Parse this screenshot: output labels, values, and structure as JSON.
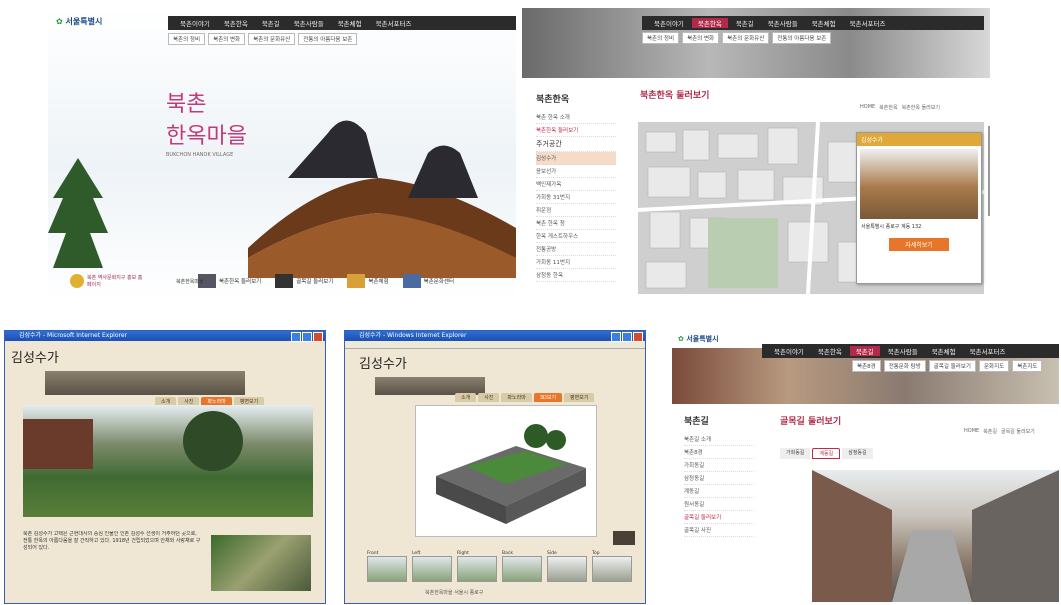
{
  "panel1": {
    "logo": "서울특별시",
    "nav": [
      "북촌이야기",
      "북촌한옥",
      "북촌길",
      "북촌사람들",
      "북촌체험",
      "북촌서포터즈"
    ],
    "subnav": [
      "북촌의 정비",
      "북촌의 변화",
      "북촌의 문화유산",
      "전통의 아름다움 보존"
    ],
    "hero_title_1": "북촌",
    "hero_title_2": "한옥마을",
    "hero_subtitle": "BUKCHON HANOK VILLAGE",
    "quick_links": [
      "북촌한옥 둘러보기",
      "골목길 둘러보기",
      "북촌체험",
      "북촌문화센터"
    ],
    "bottom_left_text": "북촌 역사문화지구 홍보 홈페이지",
    "bottom_small": "북촌한옥마을"
  },
  "panel2": {
    "nav": [
      "북촌이야기",
      "북촌한옥",
      "북촌길",
      "북촌사람들",
      "북촌체험",
      "북촌서포터즈"
    ],
    "active_nav": "북촌한옥",
    "subnav": [
      "북촌의 정비",
      "북촌의 변화",
      "북촌의 문화유산",
      "전통의 아름다움 보존"
    ],
    "side_title": "북촌한옥",
    "side_items": [
      "북촌 한옥 소개",
      "북촌한옥 둘러보기",
      "주거공간",
      "김성수가",
      "윤보선가",
      "백인제가옥",
      "가회동 31번지",
      "취운정",
      "북촌 한옥 청",
      "한옥 게스트하우스",
      "전통공방",
      "가회동 11번지",
      "삼청동 한옥"
    ],
    "page_title": "북촌한옥 둘러보기",
    "breadcrumb": [
      "HOME",
      "북촌한옥",
      "북촌한옥 둘러보기"
    ],
    "popup_title": "김성수가",
    "popup_text": "서울특별시 종로구 계동 132",
    "popup_button": "자세히보기"
  },
  "panel3": {
    "window_title": "김성수가 - Microsoft Internet Explorer",
    "page_title": "김성수가",
    "tabs": [
      "소개",
      "사진",
      "파노라마",
      "평면보기"
    ],
    "active_tab": "파노라마",
    "desc": "북촌 김성수가 고택은 근현대사의 중심 인물인 인촌 김성수 선생이 거주하던 곳으로, 전통 한옥의 아름다움을 잘 간직하고 있다. 1918년 건립되었으며 안채와 사랑채로 구성되어 있다."
  },
  "panel4": {
    "window_title": "김성수가 - Windows Internet Explorer",
    "page_title": "김성수가",
    "tabs": [
      "소개",
      "사진",
      "파노라마",
      "3D보기",
      "평면보기"
    ],
    "active_tab": "3D보기",
    "thumb_labels": [
      "Front",
      "Left",
      "Right",
      "Back",
      "Side",
      "Top"
    ],
    "footer": "북촌한옥마을 서울시 종로구"
  },
  "panel5": {
    "logo": "서울특별시",
    "nav": [
      "북촌이야기",
      "북촌한옥",
      "북촌길",
      "북촌사람들",
      "북촌체험",
      "북촌서포터즈"
    ],
    "active_nav": "북촌길",
    "subnav": [
      "북촌8경",
      "전통문화 탐방",
      "골목길 둘러보기",
      "문화지도",
      "북촌지도"
    ],
    "side_title": "북촌길",
    "side_items": [
      "북촌길 소개",
      "북촌8경",
      "가회동길",
      "삼청동길",
      "계동길",
      "원서동길",
      "골목길 둘러보기",
      "골목길 사진"
    ],
    "page_title": "골목길 둘러보기",
    "breadcrumb": [
      "HOME",
      "북촌길",
      "골목길 둘러보기"
    ],
    "tabs": [
      "가회동길",
      "계동길",
      "삼청동길"
    ]
  }
}
